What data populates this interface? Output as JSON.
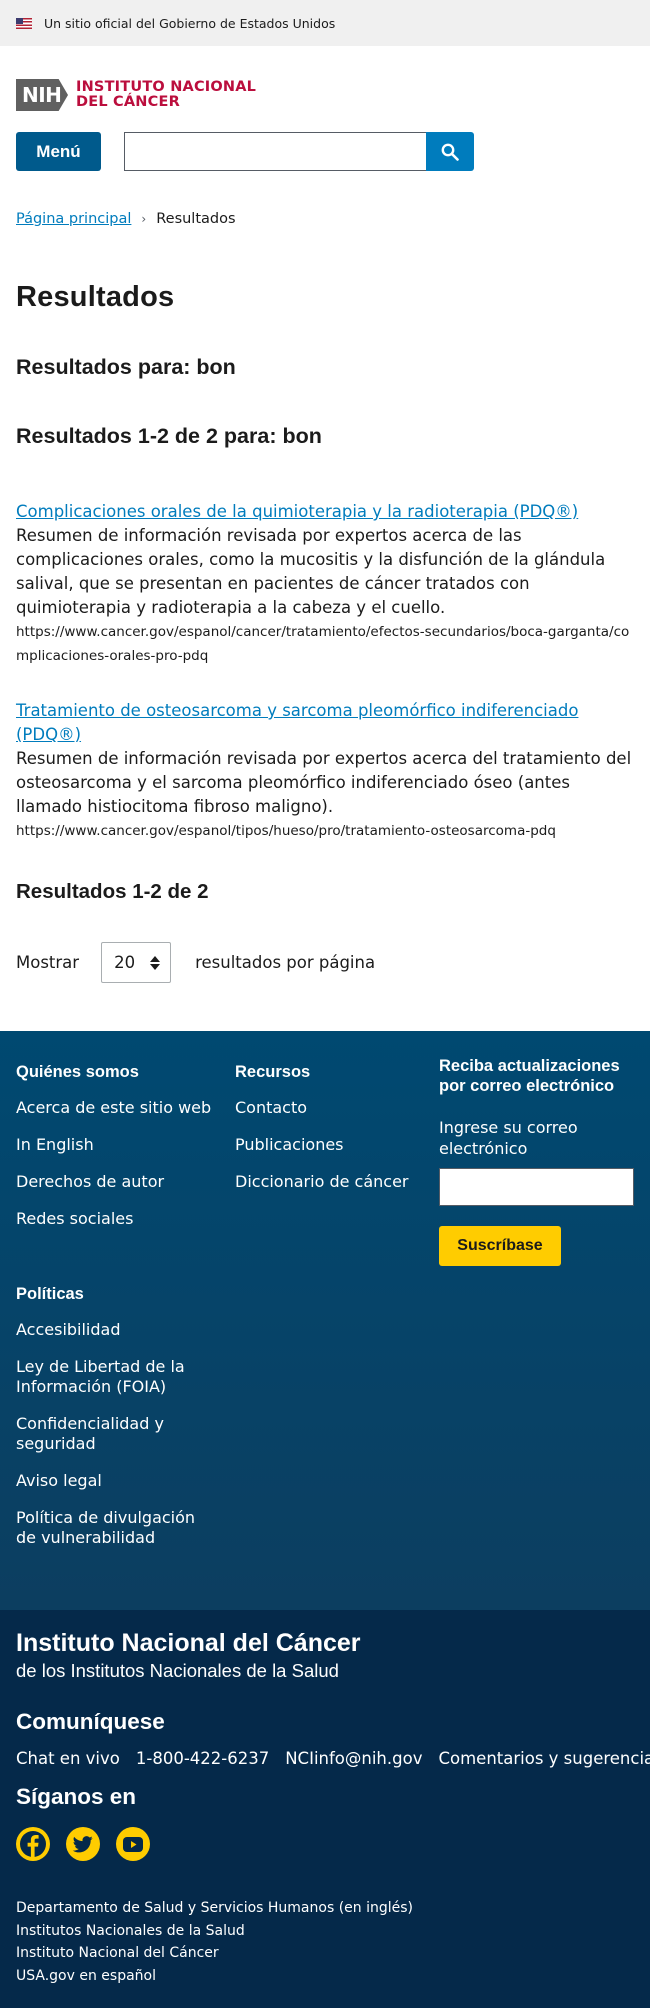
{
  "gov_banner": {
    "text": "Un sitio oficial del Gobierno de Estados Unidos"
  },
  "header": {
    "logo_abbr": "NIH",
    "logo_line1": "INSTITUTO NACIONAL",
    "logo_line2": "DEL CÁNCER",
    "menu_label": "Menú",
    "search_value": ""
  },
  "breadcrumb": {
    "home": "Página principal",
    "current": "Resultados"
  },
  "main": {
    "title": "Resultados",
    "results_for": "Resultados para: bon",
    "results_count": "Resultados 1-2 de 2 para: bon",
    "results": [
      {
        "title": "Complicaciones orales de la quimioterapia y la radioterapia (PDQ®)",
        "description": "Resumen de información revisada por expertos acerca de las complicaciones orales, como la mucositis y la disfunción de la glándula salival, que se presentan en pacientes de cáncer tratados con quimioterapia y radioterapia a la cabeza y el cuello.",
        "url": "https://www.cancer.gov/espanol/cancer/tratamiento/efectos-secundarios/boca-garganta/complicaciones-orales-pro-pdq"
      },
      {
        "title": "Tratamiento de osteosarcoma y sarcoma pleomórfico indiferenciado (PDQ®)",
        "description": "Resumen de información revisada por expertos acerca del tratamiento del osteosarcoma y el sarcoma pleomórfico indiferenciado óseo (antes llamado histiocitoma fibroso maligno).",
        "url": "https://www.cancer.gov/espanol/tipos/hueso/pro/tratamiento-osteosarcoma-pdq"
      }
    ],
    "results_bottom": "Resultados 1-2 de 2",
    "show_label": "Mostrar",
    "per_page_value": "20",
    "per_page_suffix": "resultados por página"
  },
  "footer": {
    "about": {
      "heading": "Quiénes somos",
      "links": [
        "Acerca de este sitio web",
        "In English",
        "Derechos de autor",
        "Redes sociales"
      ]
    },
    "resources": {
      "heading": "Recursos",
      "links": [
        "Contacto",
        "Publicaciones",
        "Diccionario de cáncer"
      ]
    },
    "policies": {
      "heading": "Políticas",
      "links": [
        "Accesibilidad",
        "Ley de Libertad de la Información (FOIA)",
        "Confidencialidad y seguridad",
        "Aviso legal",
        "Política de divulgación de vulnerabilidad"
      ]
    },
    "signup": {
      "title": "Reciba actualizaciones por correo electrónico",
      "label": "Ingrese su correo electrónico",
      "button": "Suscríbase"
    }
  },
  "bottom": {
    "org_name": "Instituto Nacional del Cáncer",
    "org_sub": "de los Institutos Nacionales de la Salud",
    "contact_title": "Comuníquese",
    "contacts": [
      "Chat en vivo",
      "1-800-422-6237",
      "NCIinfo@nih.gov",
      "Comentarios y sugerencias"
    ],
    "follow_title": "Síganos en",
    "socials": [
      "facebook-icon",
      "twitter-icon",
      "youtube-icon"
    ],
    "links": [
      "Departamento de Salud y Servicios Humanos (en inglés)",
      "Institutos Nacionales de la Salud",
      "Instituto Nacional del Cáncer",
      "USA.gov en español"
    ]
  },
  "colors": {
    "brand_red": "#bb0e3d",
    "primary_blue": "#005a8c",
    "link_blue": "#007cbd",
    "footer_blue": "#004971",
    "bottom_navy": "#05294a",
    "accent_yellow": "#ffcc00"
  }
}
